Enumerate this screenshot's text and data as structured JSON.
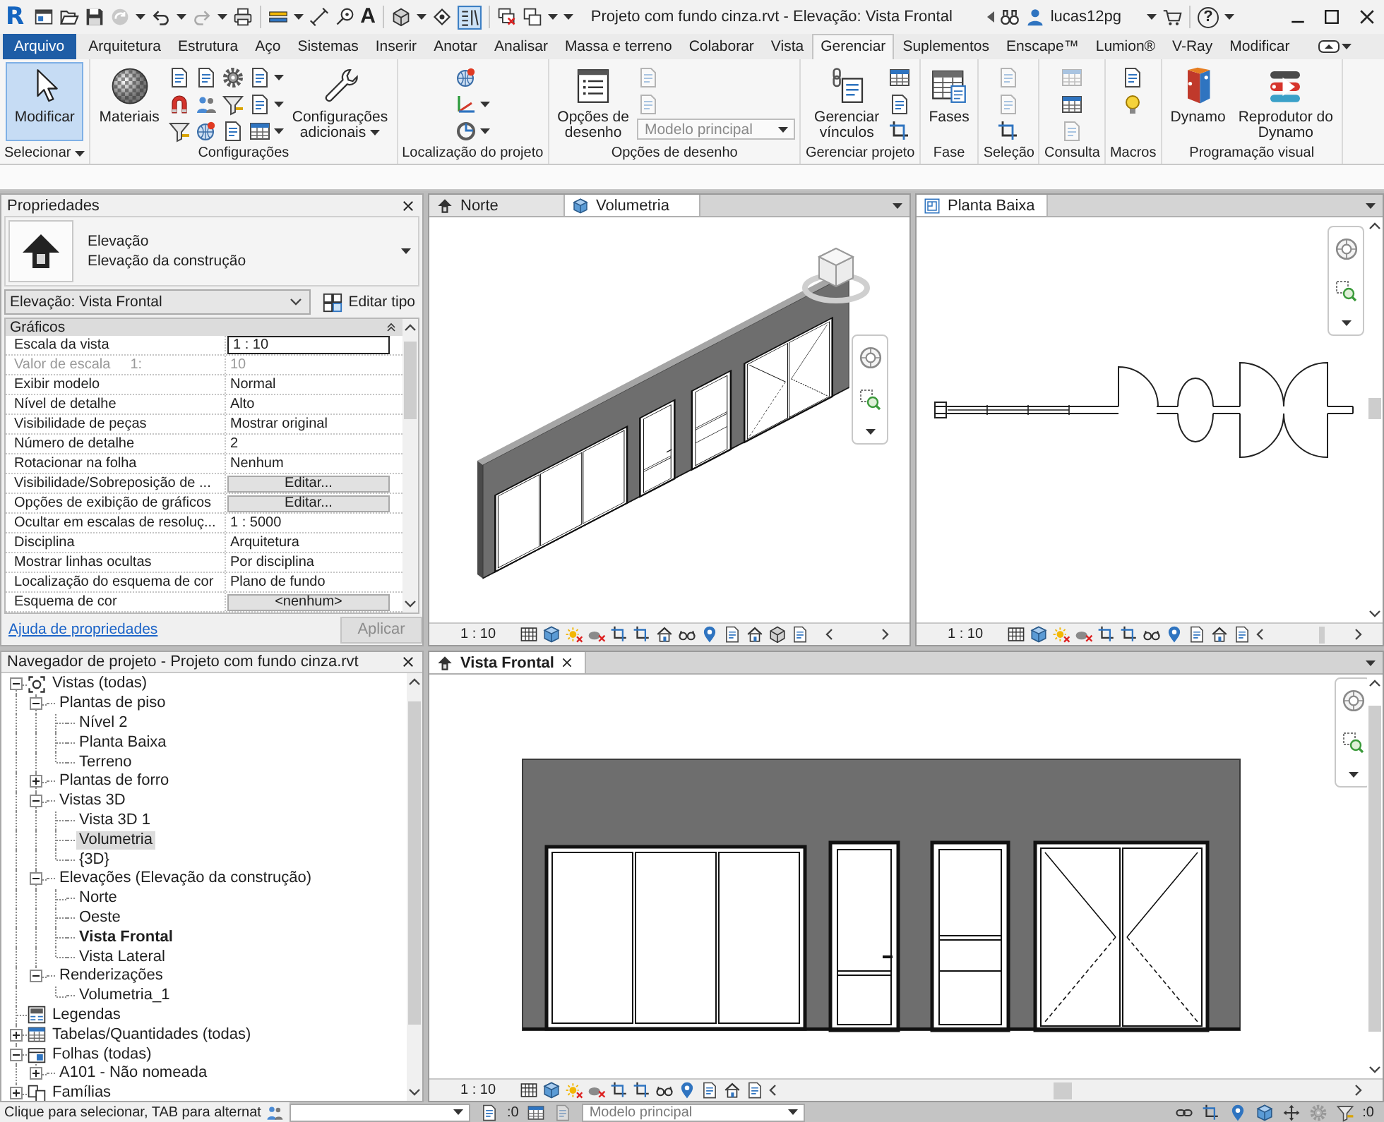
{
  "title_bar": {
    "logo": "R",
    "text_tool": "A",
    "title": "Projeto com fundo cinza.rvt - Elevação: Vista Frontal",
    "user": "lucas12pg",
    "help": "?"
  },
  "ribbon_tabs": [
    {
      "label": "Arquivo",
      "kind": "file",
      "selected": false
    },
    {
      "label": "Arquitetura",
      "kind": "tab",
      "selected": false
    },
    {
      "label": "Estrutura",
      "kind": "tab",
      "selected": false
    },
    {
      "label": "Aço",
      "kind": "tab",
      "selected": false
    },
    {
      "label": "Sistemas",
      "kind": "tab",
      "selected": false
    },
    {
      "label": "Inserir",
      "kind": "tab",
      "selected": false
    },
    {
      "label": "Anotar",
      "kind": "tab",
      "selected": false
    },
    {
      "label": "Analisar",
      "kind": "tab",
      "selected": false
    },
    {
      "label": "Massa e terreno",
      "kind": "tab",
      "selected": false
    },
    {
      "label": "Colaborar",
      "kind": "tab",
      "selected": false
    },
    {
      "label": "Vista",
      "kind": "tab",
      "selected": false
    },
    {
      "label": "Gerenciar",
      "kind": "tab",
      "selected": true
    },
    {
      "label": "Suplementos",
      "kind": "tab",
      "selected": false
    },
    {
      "label": "Enscape™",
      "kind": "tab",
      "selected": false
    },
    {
      "label": "Lumion®",
      "kind": "tab",
      "selected": false
    },
    {
      "label": "V-Ray",
      "kind": "tab",
      "selected": false
    },
    {
      "label": "Modificar",
      "kind": "tab",
      "selected": false
    }
  ],
  "ribbon_panels": [
    {
      "kind": "select",
      "title": "Selecionar",
      "menu": true,
      "items": [
        {
          "kind": "large",
          "label": "Modificar",
          "selected": true,
          "menu": false
        }
      ]
    },
    {
      "kind": "settings",
      "title": "Configurações",
      "menu": false,
      "items": [
        {
          "kind": "large",
          "label": "Materiais",
          "selected": false,
          "menu": false
        },
        {
          "kind": "stack",
          "tools": [
            {
              "disabled": false,
              "menu": false
            },
            {
              "disabled": false,
              "menu": false
            },
            {
              "disabled": false,
              "menu": false
            }
          ]
        },
        {
          "kind": "stack",
          "tools": [
            {
              "disabled": false,
              "menu": false
            },
            {
              "disabled": false,
              "menu": false
            },
            {
              "disabled": false,
              "menu": false
            }
          ]
        },
        {
          "kind": "stack",
          "tools": [
            {
              "disabled": false,
              "menu": false
            },
            {
              "disabled": false,
              "menu": false
            },
            {
              "disabled": false,
              "menu": false
            }
          ]
        },
        {
          "kind": "stack",
          "tools": [
            {
              "disabled": false,
              "menu": true
            },
            {
              "disabled": false,
              "menu": true
            },
            {
              "disabled": false,
              "menu": true
            }
          ]
        },
        {
          "kind": "large",
          "label": "Configurações adicionais",
          "selected": false,
          "menu": true
        }
      ]
    },
    {
      "kind": "location",
      "title": "Localização do projeto",
      "menu": false,
      "items": [
        {
          "kind": "stack",
          "tools": [
            {
              "disabled": false,
              "menu": false
            },
            {
              "disabled": false,
              "menu": true
            },
            {
              "disabled": false,
              "menu": true
            }
          ]
        }
      ]
    },
    {
      "kind": "design",
      "title": "Opções de desenho",
      "menu": false,
      "items": [
        {
          "kind": "large",
          "label": "Opções de desenho",
          "selected": false,
          "menu": false
        },
        {
          "kind": "stack",
          "tools": [
            {
              "disabled": true,
              "menu": false
            },
            {
              "disabled": true,
              "menu": false
            }
          ],
          "dropdown": {
            "value": "Modelo principal",
            "disabled": true
          }
        }
      ]
    },
    {
      "kind": "manage",
      "title": "Gerenciar projeto",
      "menu": false,
      "items": [
        {
          "kind": "large",
          "label": "Gerenciar vínculos",
          "selected": false,
          "menu": false
        },
        {
          "kind": "stack",
          "tools": [
            {
              "disabled": false,
              "menu": false
            },
            {
              "disabled": false,
              "menu": false
            },
            {
              "disabled": false,
              "menu": false
            }
          ]
        }
      ]
    },
    {
      "kind": "phase",
      "title": "Fase",
      "menu": false,
      "items": [
        {
          "kind": "large",
          "label": "Fases",
          "selected": false,
          "menu": false
        }
      ]
    },
    {
      "kind": "selection",
      "title": "Seleção",
      "menu": false,
      "items": [
        {
          "kind": "stack",
          "tools": [
            {
              "disabled": true,
              "menu": false
            },
            {
              "disabled": true,
              "menu": false
            },
            {
              "disabled": false,
              "menu": false
            }
          ]
        }
      ]
    },
    {
      "kind": "inquiry",
      "title": "Consulta",
      "menu": false,
      "items": [
        {
          "kind": "stack",
          "tools": [
            {
              "disabled": true,
              "menu": false
            },
            {
              "disabled": false,
              "menu": false
            },
            {
              "disabled": true,
              "menu": false
            }
          ]
        }
      ]
    },
    {
      "kind": "macros",
      "title": "Macros",
      "menu": false,
      "items": [
        {
          "kind": "stack",
          "tools": [
            {
              "disabled": false,
              "menu": false
            },
            {
              "disabled": false,
              "menu": false
            }
          ]
        }
      ]
    },
    {
      "kind": "visual",
      "title": "Programação visual",
      "menu": false,
      "items": [
        {
          "kind": "large",
          "label": "Dynamo",
          "selected": false,
          "menu": false
        },
        {
          "kind": "large",
          "label": "Reprodutor do Dynamo",
          "selected": false,
          "menu": false
        }
      ]
    }
  ],
  "properties": {
    "title": "Propriedades",
    "type_selector": {
      "family": "Elevação",
      "type": "Elevação da construção"
    },
    "instance": "Elevação: Vista Frontal",
    "edit_type": "Editar tipo",
    "group": {
      "label": "Gráficos",
      "expanded": true
    },
    "rows": [
      {
        "name": "Escala da vista",
        "kind": "field",
        "value": "1 : 10",
        "disabled": false
      },
      {
        "name": "Valor de escala",
        "suffix": "1:",
        "kind": "text",
        "value": "10",
        "disabled": true
      },
      {
        "name": "Exibir modelo",
        "kind": "text",
        "value": "Normal",
        "disabled": false
      },
      {
        "name": "Nível de detalhe",
        "kind": "text",
        "value": "Alto",
        "disabled": false
      },
      {
        "name": "Visibilidade de peças",
        "kind": "text",
        "value": "Mostrar original",
        "disabled": false
      },
      {
        "name": "Número de detalhe",
        "kind": "text",
        "value": "2",
        "disabled": false
      },
      {
        "name": "Rotacionar na folha",
        "kind": "text",
        "value": "Nenhum",
        "disabled": false
      },
      {
        "name": "Visibilidade/Sobreposição de ...",
        "kind": "button",
        "value": "Editar...",
        "disabled": false
      },
      {
        "name": "Opções de exibição de gráficos",
        "kind": "button",
        "value": "Editar...",
        "disabled": false
      },
      {
        "name": "Ocultar em escalas de resoluç...",
        "kind": "text",
        "value": "1 : 5000",
        "disabled": false
      },
      {
        "name": "Disciplina",
        "kind": "text",
        "value": "Arquitetura",
        "disabled": false
      },
      {
        "name": "Mostrar linhas ocultas",
        "kind": "text",
        "value": "Por disciplina",
        "disabled": false
      },
      {
        "name": "Localização do esquema de cor",
        "kind": "text",
        "value": "Plano de fundo",
        "disabled": false
      },
      {
        "name": "Esquema de cor",
        "kind": "button",
        "value": "<nenhum>",
        "disabled": false
      }
    ],
    "help_link": "Ajuda de propriedades",
    "apply": {
      "label": "Aplicar",
      "disabled": true
    }
  },
  "project_browser": {
    "title": "Navegador de projeto - Projeto com fundo cinza.rvt",
    "tree": [
      {
        "label": "Vistas (todas)",
        "expanded": true,
        "selected": false,
        "current": false,
        "children": [
          {
            "label": "Plantas de piso",
            "expanded": true,
            "selected": false,
            "current": false,
            "children": [
              {
                "label": "Nível 2",
                "selected": false,
                "current": false
              },
              {
                "label": "Planta Baixa",
                "selected": false,
                "current": false
              },
              {
                "label": "Terreno",
                "selected": false,
                "current": false
              }
            ]
          },
          {
            "label": "Plantas de forro",
            "expanded": false,
            "selected": false,
            "current": false
          },
          {
            "label": "Vistas 3D",
            "expanded": true,
            "selected": false,
            "current": false,
            "children": [
              {
                "label": "Vista 3D 1",
                "selected": false,
                "current": false
              },
              {
                "label": "Volumetria",
                "selected": true,
                "current": false
              },
              {
                "label": "{3D}",
                "selected": false,
                "current": false
              }
            ]
          },
          {
            "label": "Elevações (Elevação da construção)",
            "expanded": true,
            "selected": false,
            "current": false,
            "children": [
              {
                "label": "Norte",
                "selected": false,
                "current": false
              },
              {
                "label": "Oeste",
                "selected": false,
                "current": false
              },
              {
                "label": "Vista Frontal",
                "selected": false,
                "current": true
              },
              {
                "label": "Vista Lateral",
                "selected": false,
                "current": false
              }
            ]
          },
          {
            "label": "Renderizações",
            "expanded": true,
            "selected": false,
            "current": false,
            "children": [
              {
                "label": "Volumetria_1",
                "selected": false,
                "current": false
              }
            ]
          }
        ]
      },
      {
        "label": "Legendas",
        "selected": false,
        "current": false
      },
      {
        "label": "Tabelas/Quantidades (todas)",
        "expanded": false,
        "selected": false,
        "current": false
      },
      {
        "label": "Folhas (todas)",
        "expanded": true,
        "selected": false,
        "current": false,
        "children": [
          {
            "label": "A101 - Não nomeada",
            "expanded": false,
            "selected": false,
            "current": false
          }
        ]
      },
      {
        "label": "Famílias",
        "expanded": false,
        "selected": false,
        "current": false
      }
    ]
  },
  "views": [
    {
      "kind": "perspective",
      "focused": false,
      "tabs": [
        {
          "label": "Norte",
          "kind": "elevation",
          "selected": false
        },
        {
          "label": "Volumetria",
          "kind": "perspective",
          "selected": true
        }
      ],
      "scale": "1 : 10"
    },
    {
      "kind": "plan",
      "focused": false,
      "tabs": [
        {
          "label": "Planta Baixa",
          "kind": "plan",
          "selected": true
        }
      ],
      "scale": "1 : 10"
    },
    {
      "kind": "elevation",
      "focused": true,
      "tabs": [
        {
          "label": "Vista Frontal",
          "kind": "elevation",
          "selected": true
        }
      ],
      "scale": "1 : 10"
    }
  ],
  "status_bar": {
    "prompt": "Clique para selecionar, TAB para alternat",
    "editable_count": ":0",
    "design_option": "Modelo principal",
    "filter_count": ":0"
  }
}
